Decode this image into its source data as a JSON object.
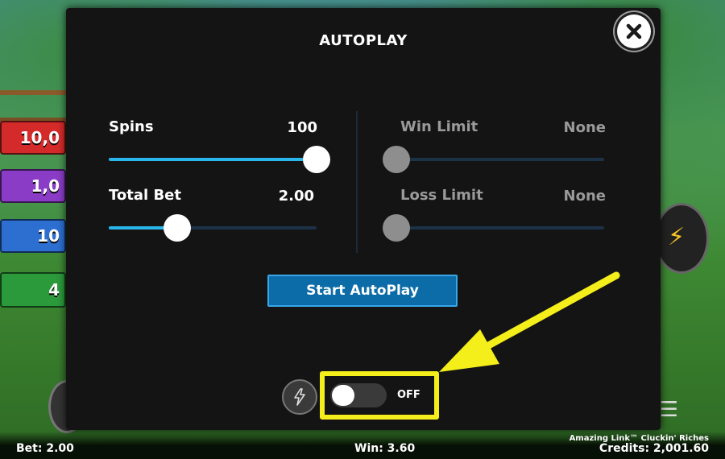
{
  "dialog": {
    "title": "AUTOPLAY",
    "close_icon": "close-icon",
    "spins": {
      "label": "Spins",
      "value": "100",
      "level": 1.0
    },
    "total_bet": {
      "label": "Total Bet",
      "value": "2.00",
      "level": 0.33
    },
    "win_limit": {
      "label": "Win Limit",
      "value": "None",
      "level": 0.0
    },
    "loss_limit": {
      "label": "Loss Limit",
      "value": "None",
      "level": 0.0
    },
    "start_button": "Start AutoPlay",
    "turbo_icon": "lightning-icon",
    "toggle_label": "OFF",
    "toggle_on": false
  },
  "status_bar": {
    "bet": "Bet: 2.00",
    "win": "Win: 3.60",
    "game_title": "Amazing Link™ Cluckin' Riches",
    "credits": "Credits: 2,001.60"
  },
  "background": {
    "logo_text": "AMAZING LINK CLUCKIN' RICHES",
    "multipliers": [
      "10,0",
      "1,0",
      "10",
      "4"
    ]
  },
  "colors": {
    "accent": "#29b6ea",
    "start_button": "#0c6ca8",
    "highlight": "#f4ee1a",
    "dialog_bg": "#141414"
  }
}
